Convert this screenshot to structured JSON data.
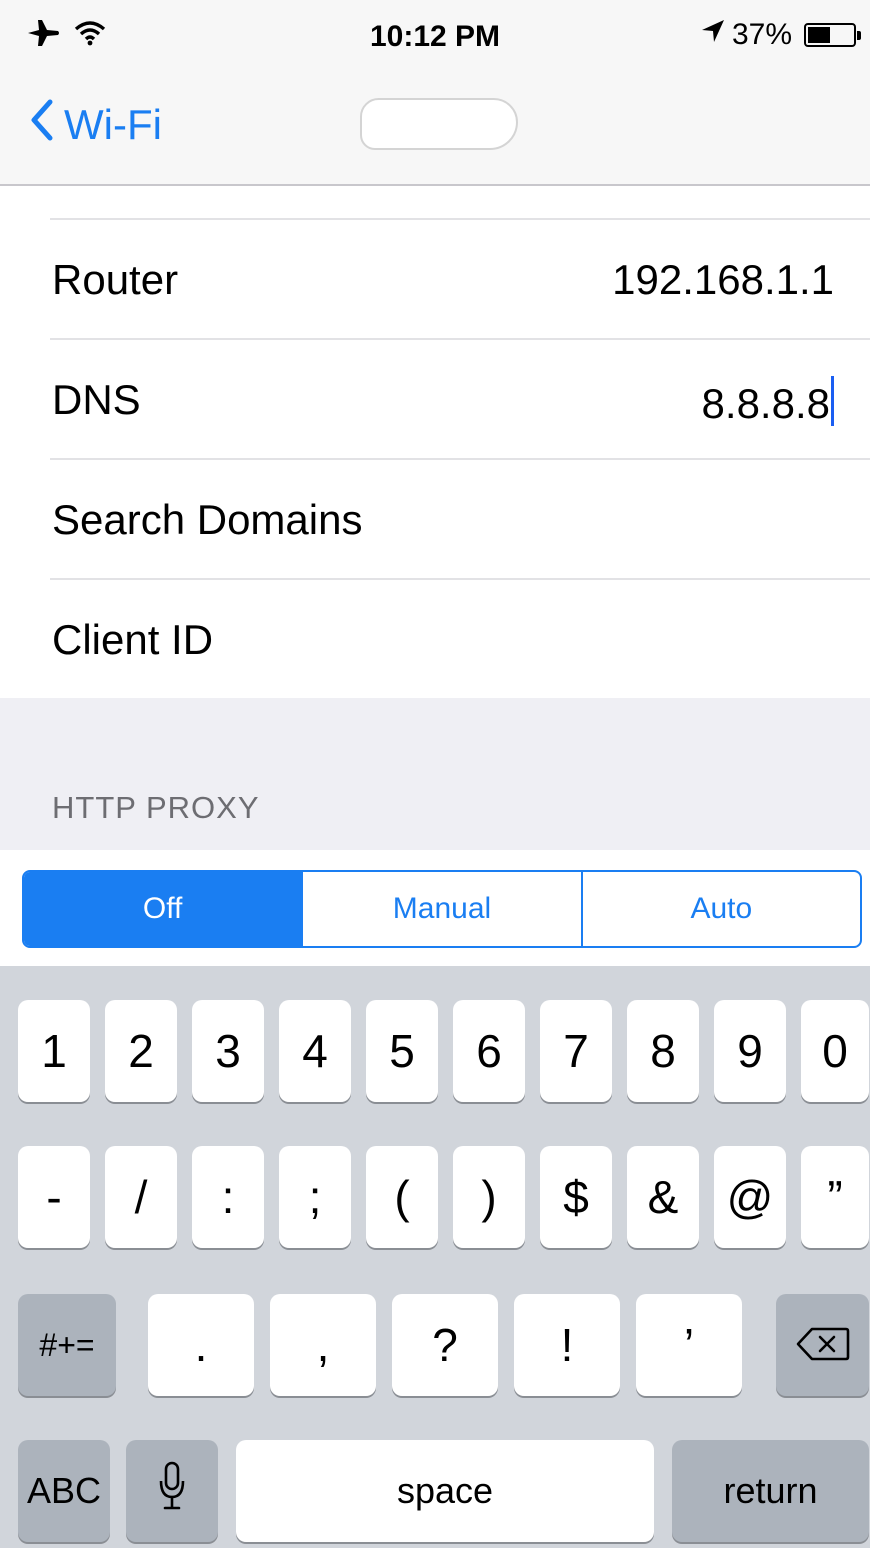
{
  "status_bar": {
    "time": "10:12 PM",
    "battery_text": "37%",
    "battery_level": 0.37
  },
  "nav": {
    "back_label": "Wi-Fi"
  },
  "rows": [
    {
      "label": "Router",
      "value": "192.168.1.1"
    },
    {
      "label": "DNS",
      "value": "8.8.8.8"
    },
    {
      "label": "Search Domains",
      "value": ""
    },
    {
      "label": "Client ID",
      "value": ""
    }
  ],
  "section": {
    "http_proxy_header": "HTTP PROXY"
  },
  "proxy_segments": {
    "options": [
      "Off",
      "Manual",
      "Auto"
    ],
    "selected": "Off"
  },
  "keyboard": {
    "row1": [
      "1",
      "2",
      "3",
      "4",
      "5",
      "6",
      "7",
      "8",
      "9",
      "0"
    ],
    "row2": [
      "-",
      "/",
      ":",
      ";",
      "(",
      ")",
      "$",
      "&",
      "@",
      "”"
    ],
    "row3_mode": "#+=",
    "row3": [
      ".",
      ",",
      "?",
      "!",
      "’"
    ],
    "abc": "ABC",
    "space": "space",
    "return": "return"
  },
  "colors": {
    "accent": "#1a7ef2",
    "keyboard_bg": "#d1d5db",
    "section_bg": "#efeff4"
  }
}
